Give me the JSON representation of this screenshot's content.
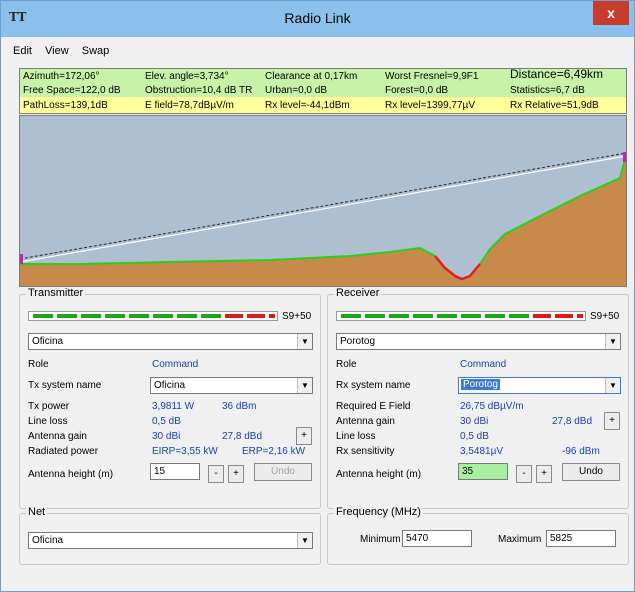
{
  "window": {
    "title": "Radio Link",
    "icon": "TT",
    "close": "x"
  },
  "menu": [
    "Edit",
    "View",
    "Swap"
  ],
  "info": {
    "r1": [
      "Azimuth=172,06°",
      "Elev. angle=3,734°",
      "Clearance at 0,17km",
      "Worst Fresnel=9,9F1",
      "Distance=6,49km"
    ],
    "r2": [
      "Free Space=122,0 dB",
      "Obstruction=10,4 dB TR",
      "Urban=0,0 dB",
      "Forest=0,0 dB",
      "Statistics=6,7 dB"
    ],
    "r3": [
      "PathLoss=139,1dB",
      "E field=78,7dBµV/m",
      "Rx level=-44,1dBm",
      "Rx level=1399,77µV",
      "Rx Relative=51,9dB"
    ]
  },
  "colors": {
    "terrain": "#c88a4a",
    "terrain_edge": "#2ecc1e",
    "obstruction": "#e0201c",
    "sky": "#aebfd0",
    "green_seg": "#1aa51a",
    "red_seg": "#e01818"
  },
  "transmitter": {
    "legend": "Transmitter",
    "meter_label": "S9+50",
    "system": "Oficina",
    "role_label": "Role",
    "role_value": "Command",
    "txname_label": "Tx system name",
    "txname_value": "Oficina",
    "power_label": "Tx power",
    "power_w": "3,9811 W",
    "power_dbm": "36 dBm",
    "lineloss_label": "Line loss",
    "lineloss_value": "0,5 dB",
    "gain_label": "Antenna gain",
    "gain_dbi": "30 dBi",
    "gain_dbd": "27,8 dBd",
    "radiated_label": "Radiated power",
    "eirp": "EIRP=3,55 kW",
    "erp": "ERP=2,16 kW",
    "height_label": "Antenna height (m)",
    "height_value": "15",
    "minus": "-",
    "plus": "+",
    "undo": "Undo"
  },
  "receiver": {
    "legend": "Receiver",
    "meter_label": "S9+50",
    "system": "Porotog",
    "role_label": "Role",
    "role_value": "Command",
    "rxname_label": "Rx system name",
    "rxname_value": "Porotog",
    "reqfield_label": "Required E Field",
    "reqfield_value": "26,75 dBµV/m",
    "gain_label": "Antenna gain",
    "gain_dbi": "30 dBi",
    "gain_dbd": "27,8 dBd",
    "lineloss_label": "Line loss",
    "lineloss_value": "0,5 dB",
    "sens_label": "Rx sensitivity",
    "sens_uv": "3,5481µV",
    "sens_dbm": "-96 dBm",
    "height_label": "Antenna height (m)",
    "height_value": "35",
    "minus": "-",
    "plus": "+",
    "undo": "Undo"
  },
  "net": {
    "legend": "Net",
    "value": "Oficina"
  },
  "frequency": {
    "legend": "Frequency (MHz)",
    "min_label": "Minimum",
    "min_value": "5470",
    "max_label": "Maximum",
    "max_value": "5825"
  }
}
